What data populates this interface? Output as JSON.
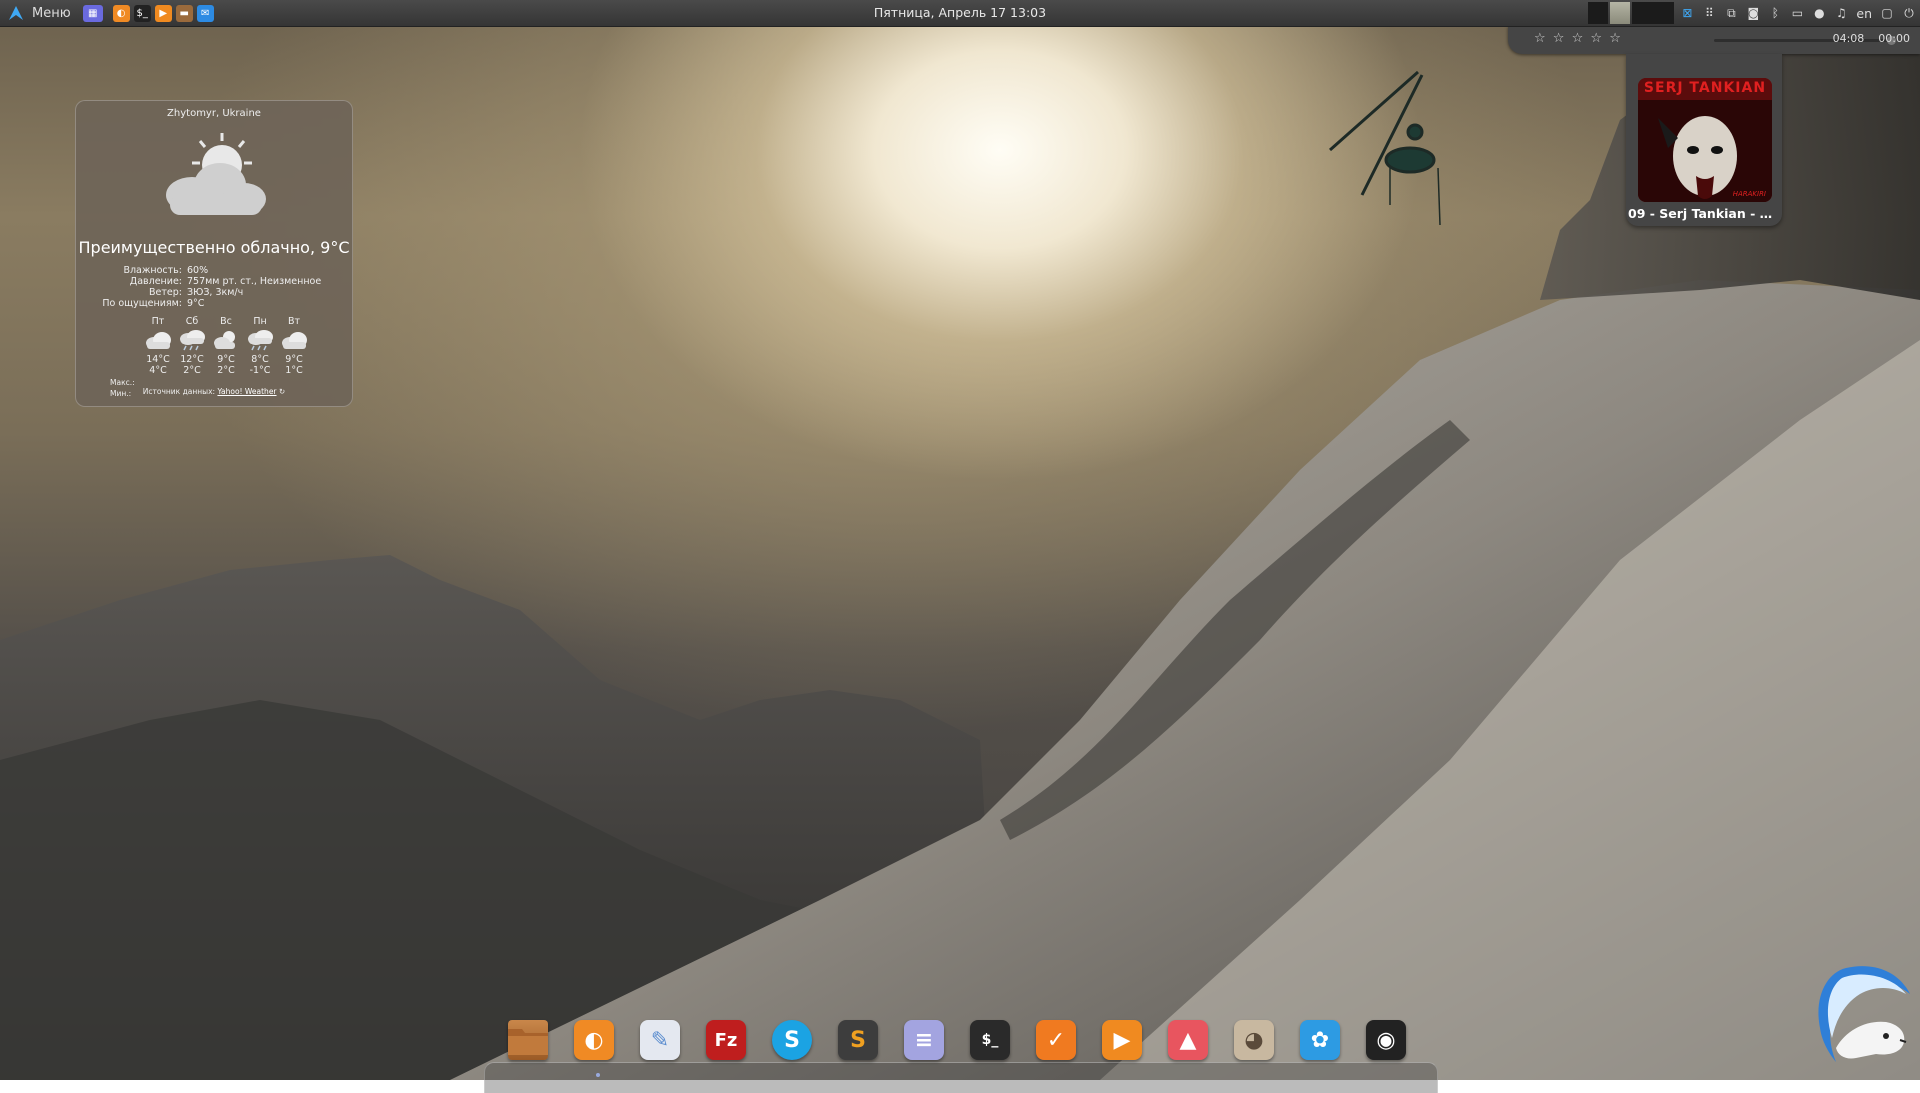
{
  "top_panel": {
    "menu_label": "Меню",
    "clock": "Пятница, Апрель 17  13:03",
    "language": "en",
    "launcher_icons": [
      "workspace-icon",
      "firefox-icon",
      "terminal-icon",
      "media-player-icon",
      "files-icon",
      "thunderbird-icon"
    ],
    "tray_icons": [
      "workspace-switcher-icon",
      "apps-grid-icon",
      "screenshot-icon",
      "camera-icon",
      "bluetooth-icon",
      "network-icon",
      "user-icon",
      "music-icon",
      "window-icon",
      "power-icon"
    ]
  },
  "player": {
    "stars": [
      "☆",
      "☆",
      "☆",
      "☆",
      "☆"
    ],
    "elapsed": "04:08",
    "remaining": "00:00",
    "progress": 1.0,
    "album_art_text": "SERJ TANKIAN",
    "album_art_subtext": "HARAKIRI",
    "track_title": "09 - Serj Tankian - Re..."
  },
  "weather": {
    "location": "Zhytomyr, Ukraine",
    "condition": "Преимущественно облачно, 9°C",
    "details": [
      {
        "key": "Влажность:",
        "value": "60%"
      },
      {
        "key": "Давление:",
        "value": "757мм рт. ст., Неизменное"
      },
      {
        "key": "Ветер:",
        "value": "ЗЮЗ, 3км/ч"
      },
      {
        "key": "По ощущениям:",
        "value": "9°C"
      }
    ],
    "max_label": "Макс.:",
    "min_label": "Мин.:",
    "forecast": [
      {
        "day": "Пт",
        "max": "14°C",
        "min": "4°C",
        "icon": "cloudy-icon"
      },
      {
        "day": "Сб",
        "max": "12°C",
        "min": "2°C",
        "icon": "rain-icon"
      },
      {
        "day": "Вс",
        "max": "9°C",
        "min": "2°C",
        "icon": "partly-cloudy-icon"
      },
      {
        "day": "Пн",
        "max": "8°C",
        "min": "-1°C",
        "icon": "rain-icon"
      },
      {
        "day": "Вт",
        "max": "9°C",
        "min": "1°C",
        "icon": "cloudy-icon"
      }
    ],
    "source_prefix": "Источник данных:",
    "source_link": "Yahoo! Weather"
  },
  "dock": {
    "apps": [
      {
        "name": "files",
        "glyph": "",
        "color": "#b8753c"
      },
      {
        "name": "firefox",
        "glyph": "◐",
        "color": "#f08a24"
      },
      {
        "name": "writer",
        "glyph": "✎",
        "color": "#e4e8f0"
      },
      {
        "name": "filezilla",
        "glyph": "Fz",
        "color": "#bf1e1e"
      },
      {
        "name": "skype",
        "glyph": "S",
        "color": "#1ba3e3"
      },
      {
        "name": "sublime-text",
        "glyph": "S",
        "color": "#3d3d3d"
      },
      {
        "name": "text-editor",
        "glyph": "≡",
        "color": "#a3a4e0"
      },
      {
        "name": "terminal",
        "glyph": "$_",
        "color": "#2a2a2a"
      },
      {
        "name": "office-presentation",
        "glyph": "✓",
        "color": "#f07a20"
      },
      {
        "name": "media-player",
        "glyph": "▶",
        "color": "#f08a20"
      },
      {
        "name": "image-viewer",
        "glyph": "▲",
        "color": "#e8555f"
      },
      {
        "name": "gimp",
        "glyph": "◕",
        "color": "#c8b8a0"
      },
      {
        "name": "settings",
        "glyph": "✿",
        "color": "#2d9be3"
      },
      {
        "name": "steam",
        "glyph": "◉",
        "color": "#222"
      }
    ]
  }
}
